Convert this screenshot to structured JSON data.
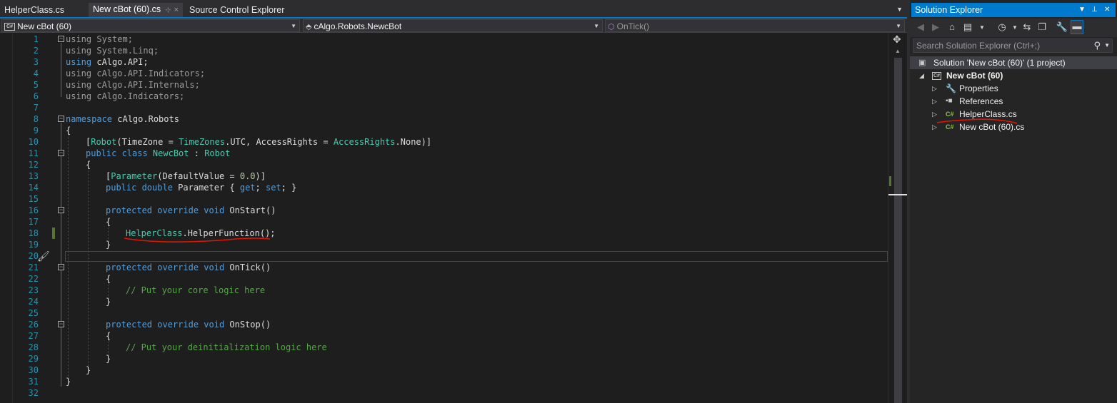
{
  "tabs": [
    {
      "label": "HelperClass.cs"
    },
    {
      "label": "New cBot (60).cs",
      "pin": "⊹",
      "close": "×"
    },
    {
      "label": "Source Control Explorer"
    }
  ],
  "navbar": {
    "project": "New cBot (60)",
    "type": "cAlgo.Robots.NewcBot",
    "member": "OnTick()"
  },
  "editor": {
    "line_numbers": [
      "1",
      "2",
      "3",
      "4",
      "5",
      "6",
      "7",
      "8",
      "9",
      "10",
      "11",
      "12",
      "13",
      "14",
      "15",
      "16",
      "17",
      "18",
      "19",
      "20",
      "21",
      "22",
      "23",
      "24",
      "25",
      "26",
      "27",
      "28",
      "29",
      "30",
      "31",
      "32"
    ],
    "lines": {
      "l1": {
        "kw": "using",
        "rest": " System;"
      },
      "l2": {
        "kw": "using",
        "rest": " System.Linq;"
      },
      "l3": {
        "kw": "using",
        "rest": " cAlgo.API;"
      },
      "l4": {
        "kw": "using",
        "rest": " cAlgo.API.Indicators;"
      },
      "l5": {
        "kw": "using",
        "rest": " cAlgo.API.Internals;"
      },
      "l6": {
        "kw": "using",
        "rest": " cAlgo.Indicators;"
      },
      "l8": {
        "kw": "namespace",
        "rest": " cAlgo.Robots"
      },
      "l9": "{",
      "l10": {
        "a": "[",
        "b": "Robot",
        "c": "(TimeZone = ",
        "d": "TimeZones",
        "e": ".UTC, AccessRights = ",
        "f": "AccessRights",
        "g": ".None)]"
      },
      "l11": {
        "kw": "public class",
        "name": " NewcBot",
        "colon": " : ",
        "base": "Robot"
      },
      "l12": "{",
      "l13": {
        "a": "[",
        "b": "Parameter",
        "c": "(DefaultValue = ",
        "num": "0.0",
        "d": ")]"
      },
      "l14": {
        "kw": "public double",
        "name": " Parameter { ",
        "get": "get",
        "semi": "; ",
        "set": "set",
        "end": "; }"
      },
      "l16": {
        "kw": "protected override void",
        "rest": " OnStart()"
      },
      "l17": "{",
      "l18": {
        "type": "HelperClass",
        "rest": ".HelperFunction();"
      },
      "l19": "}",
      "l21": {
        "kw": "protected override void",
        "rest": " OnTick()"
      },
      "l22": "{",
      "l23": "// Put your core logic here",
      "l24": "}",
      "l26": {
        "kw": "protected override void",
        "rest": " OnStop()"
      },
      "l27": "{",
      "l28": "// Put your deinitialization logic here",
      "l29": "}",
      "l30": "}",
      "l31": "}"
    }
  },
  "solution_explorer": {
    "title": "Solution Explorer",
    "search_placeholder": "Search Solution Explorer (Ctrl+;)",
    "tree": [
      {
        "label": "Solution 'New cBot (60)' (1 project)"
      },
      {
        "label": "New cBot (60)"
      },
      {
        "label": "Properties"
      },
      {
        "label": "References"
      },
      {
        "label": "HelperClass.cs"
      },
      {
        "label": "New cBot (60).cs"
      }
    ]
  },
  "colors": {
    "accent": "#007acc",
    "keyword": "#569cd6",
    "type": "#4ec9b0",
    "comment": "#57a64a",
    "annotation": "#e51400"
  }
}
